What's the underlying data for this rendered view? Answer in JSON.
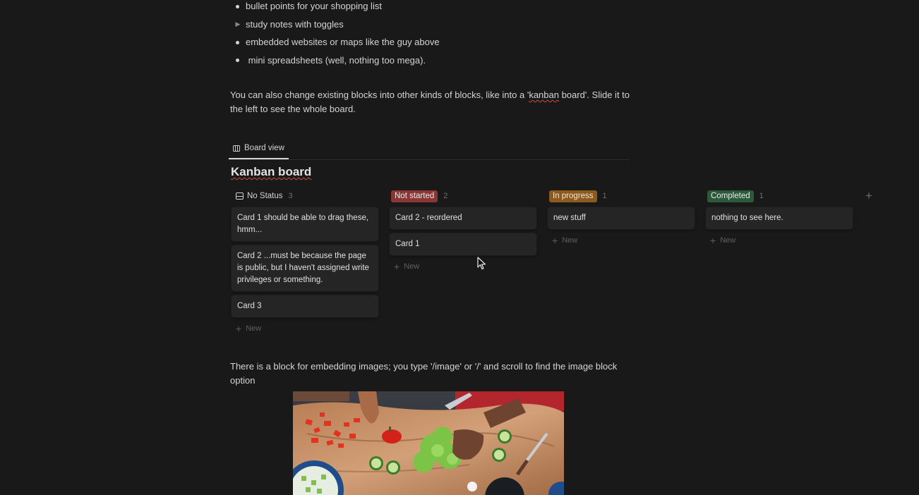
{
  "bullets": [
    {
      "marker": "dot",
      "text": "bullet points for your shopping list"
    },
    {
      "marker": "toggle",
      "text": "study notes with toggles"
    },
    {
      "marker": "dot",
      "text": "embedded websites or maps like the guy above"
    },
    {
      "marker": "dot",
      "text": " mini spreadsheets (well, nothing too mega)."
    }
  ],
  "paragraph_blocks": {
    "part1": "You can also change existing blocks into other kinds of blocks, like into a '",
    "kanban_word": "kanban",
    "part2": " board'.  Slide it to the left to see the whole board."
  },
  "board": {
    "tab_label": "Board view",
    "title": "Kanban board",
    "new_label": "New",
    "columns": [
      {
        "name": "No Status",
        "count": "3",
        "color": null,
        "cards": [
          "Card 1 should be able to drag these, hmm...",
          "Card 2 ...must be because the page is public, but I haven't assigned write privileges or something.",
          "Card 3"
        ]
      },
      {
        "name": "Not started",
        "count": "2",
        "color": "#8a3634",
        "cards": [
          "Card 2 - reordered",
          "Card 1"
        ]
      },
      {
        "name": "In progress",
        "count": "1",
        "color": "#8c5a1c",
        "cards": [
          "new stuff"
        ]
      },
      {
        "name": "Completed",
        "count": "1",
        "color": "#2b5a3b",
        "cards": [
          "nothing to see here."
        ]
      }
    ]
  },
  "image_paragraph": "There is a block for embedding images; you type '/image' or '/' and scroll to find the image block option",
  "image": {
    "subject": "hands chopping vegetables on a wooden board"
  }
}
